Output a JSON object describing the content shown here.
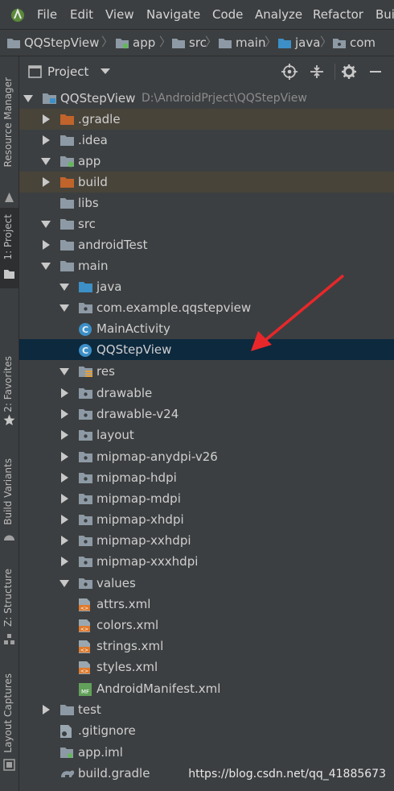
{
  "menu": {
    "items": [
      "File",
      "Edit",
      "View",
      "Navigate",
      "Code",
      "Analyze",
      "Refactor",
      "Buil"
    ],
    "logo_icon": "android-studio-logo-icon"
  },
  "breadcrumb": {
    "items": [
      "QQStepView",
      "app",
      "src",
      "main",
      "java",
      "com"
    ]
  },
  "left_strip": {
    "tabs": [
      "Resource Manager",
      "1: Project",
      "2: Favorites",
      "Build Variants",
      "Z: Structure",
      "Layout Captures"
    ]
  },
  "project_panel": {
    "title": "Project",
    "toolbar_icons": [
      "target-icon",
      "collapse-icon",
      "gear-icon",
      "minimize-icon"
    ]
  },
  "tree": [
    {
      "label": "QQStepView",
      "path": "D:\\AndroidPrject\\QQStepView",
      "arrow": "down",
      "icon": "folder-project-icon"
    },
    {
      "label": ".gradle",
      "arrow": "right",
      "icon": "folder-orange-icon"
    },
    {
      "label": ".idea",
      "arrow": "right",
      "icon": "folder-icon"
    },
    {
      "label": "app",
      "arrow": "down",
      "icon": "folder-module-icon"
    },
    {
      "label": "build",
      "arrow": "right",
      "icon": "folder-orange-icon"
    },
    {
      "label": "libs",
      "arrow": "none",
      "icon": "folder-icon"
    },
    {
      "label": "src",
      "arrow": "down",
      "icon": "folder-icon"
    },
    {
      "label": "androidTest",
      "arrow": "right",
      "icon": "folder-icon"
    },
    {
      "label": "main",
      "arrow": "down",
      "icon": "folder-icon"
    },
    {
      "label": "java",
      "arrow": "down",
      "icon": "folder-blue-icon"
    },
    {
      "label": "com.example.qqstepview",
      "arrow": "down",
      "icon": "package-icon"
    },
    {
      "label": "MainActivity",
      "arrow": "none",
      "icon": "class-icon"
    },
    {
      "label": "QQStepView",
      "arrow": "none",
      "icon": "class-icon"
    },
    {
      "label": "res",
      "arrow": "down",
      "icon": "folder-res-icon"
    },
    {
      "label": "drawable",
      "arrow": "right",
      "icon": "package-icon"
    },
    {
      "label": "drawable-v24",
      "arrow": "right",
      "icon": "package-icon"
    },
    {
      "label": "layout",
      "arrow": "right",
      "icon": "package-icon"
    },
    {
      "label": "mipmap-anydpi-v26",
      "arrow": "right",
      "icon": "package-icon"
    },
    {
      "label": "mipmap-hdpi",
      "arrow": "right",
      "icon": "package-icon"
    },
    {
      "label": "mipmap-mdpi",
      "arrow": "right",
      "icon": "package-icon"
    },
    {
      "label": "mipmap-xhdpi",
      "arrow": "right",
      "icon": "package-icon"
    },
    {
      "label": "mipmap-xxhdpi",
      "arrow": "right",
      "icon": "package-icon"
    },
    {
      "label": "mipmap-xxxhdpi",
      "arrow": "right",
      "icon": "package-icon"
    },
    {
      "label": "values",
      "arrow": "down",
      "icon": "package-icon"
    },
    {
      "label": "attrs.xml",
      "arrow": "none",
      "icon": "xml-file-icon"
    },
    {
      "label": "colors.xml",
      "arrow": "none",
      "icon": "xml-file-icon"
    },
    {
      "label": "strings.xml",
      "arrow": "none",
      "icon": "xml-file-icon"
    },
    {
      "label": "styles.xml",
      "arrow": "none",
      "icon": "xml-file-icon"
    },
    {
      "label": "AndroidManifest.xml",
      "arrow": "none",
      "icon": "manifest-file-icon"
    },
    {
      "label": "test",
      "arrow": "right",
      "icon": "folder-icon"
    },
    {
      "label": ".gitignore",
      "arrow": "none",
      "icon": "gitignore-file-icon"
    },
    {
      "label": "app.iml",
      "arrow": "none",
      "icon": "iml-file-icon"
    },
    {
      "label": "build.gradle",
      "arrow": "none",
      "icon": "gradle-file-icon"
    }
  ],
  "watermark": "https://blog.csdn.net/qq_41885673",
  "colors": {
    "background": "#3c3f41",
    "selection": "#0d293e",
    "excluded_highlight": "#48443a",
    "folder": "#8d9aa5",
    "folder_orange": "#c0642c",
    "folder_blue": "#3d8fc7",
    "class_badge": "#3d8fc7",
    "annotation_arrow": "#e8272a"
  }
}
